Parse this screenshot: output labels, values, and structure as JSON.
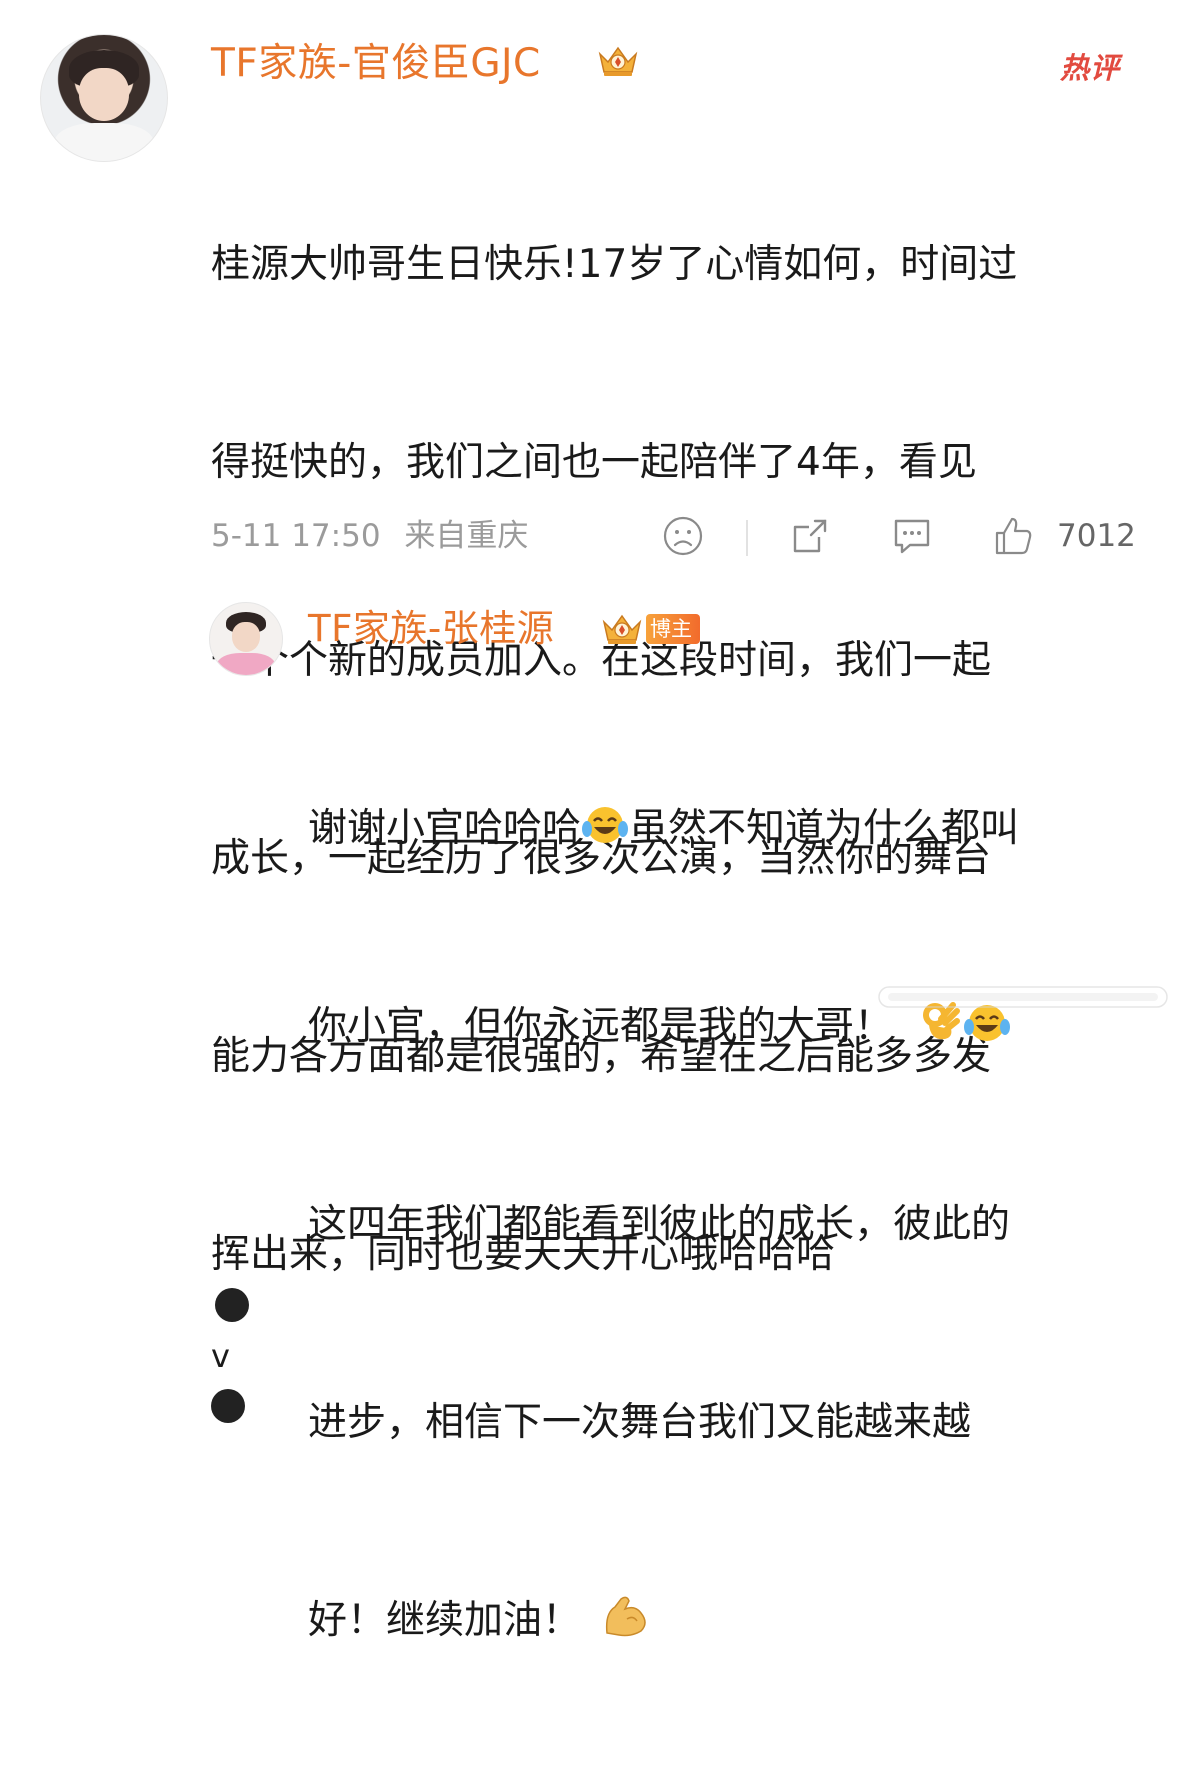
{
  "comment": {
    "author": "TF家族-官俊臣GJC",
    "hot_label": "热评",
    "lines": [
      "桂源大帅哥生日快乐!17岁了心情如何，时间过",
      "得挺快的，我们之间也一起陪伴了4年，看见",
      "一个个新的成员加入。在这段时间，我们一起",
      "成长，一起经历了很多次公演，当然你的舞台",
      "能力各方面都是很强的，希望在之后能多多发",
      "挥出来，同时也要天天开心哦哈哈哈"
    ],
    "emoticon_mid": "v",
    "timestamp": "5-11 17:50",
    "location": "来自重庆",
    "like_count": "7012",
    "icons": [
      "sad-face-icon",
      "share-icon",
      "comment-icon",
      "thumbs-up-icon"
    ]
  },
  "reply": {
    "author": "TF家族-张桂源",
    "badge": "博主",
    "lines": [
      {
        "text": "谢谢小官哈哈哈",
        "emoji": "tears-of-joy",
        "rest": "虽然不知道为什么都叫"
      },
      {
        "text": "你小官，但你永远都是我的大哥！",
        "emoji2": [
          "ok-hand",
          "tears-of-joy"
        ]
      },
      {
        "text": "这四年我们都能看到彼此的成长，彼此的"
      },
      {
        "text": "进步，相信下一次舞台我们又能越来越"
      },
      {
        "text": "好！继续加油！",
        "emoji": "flexed-biceps"
      }
    ]
  },
  "colors": {
    "name": "#e8762c",
    "hot": "#e24a3f",
    "meta": "#9b9b9b",
    "text": "#1a1a1a"
  }
}
